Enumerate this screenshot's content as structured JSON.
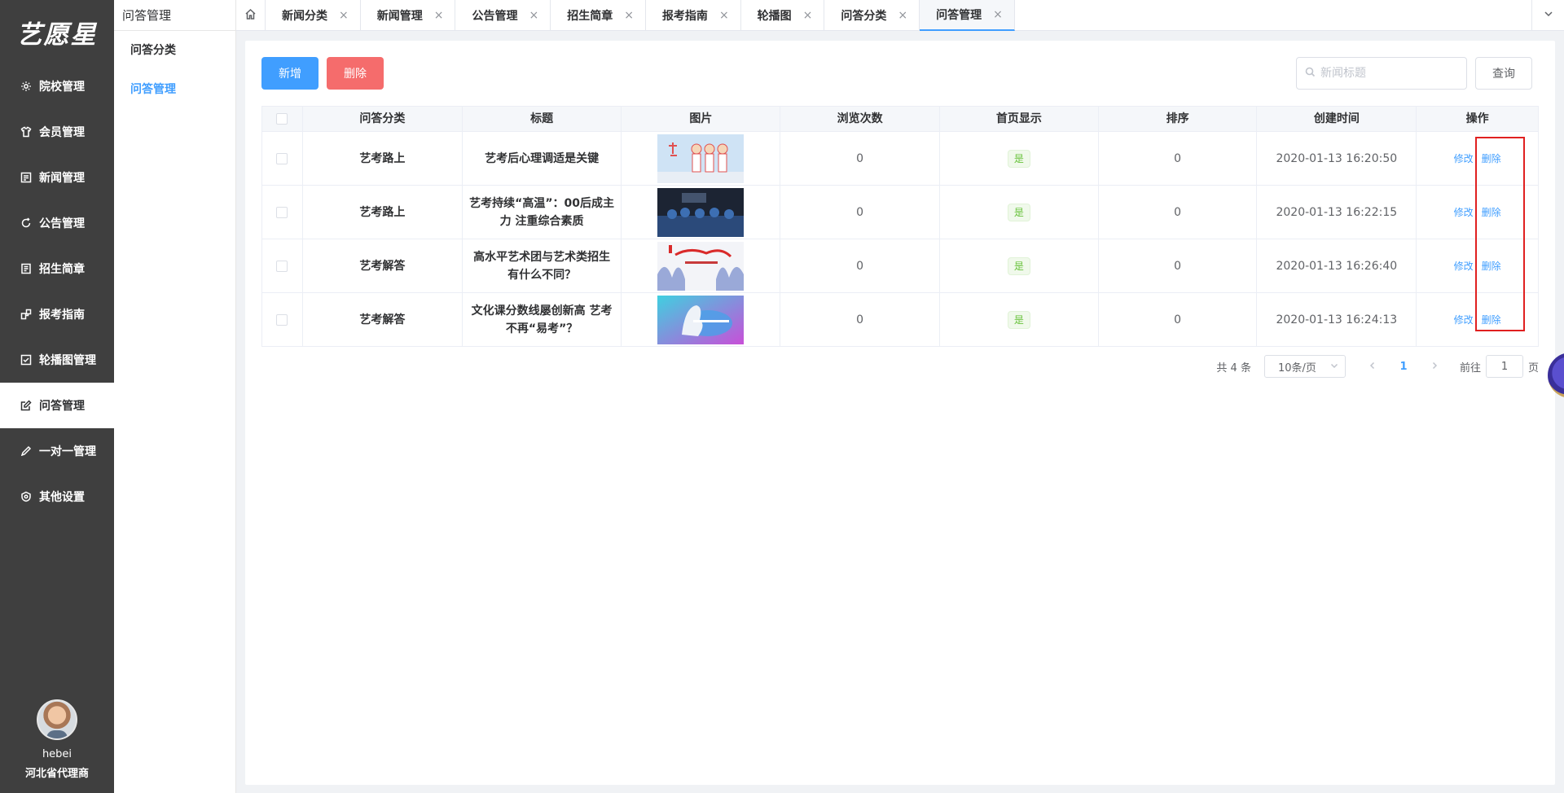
{
  "brand": {
    "logo_text": "艺愿星"
  },
  "sidebar": {
    "items": [
      {
        "label": "院校管理",
        "icon": "gear-icon"
      },
      {
        "label": "会员管理",
        "icon": "shirt-icon"
      },
      {
        "label": "新闻管理",
        "icon": "document-icon"
      },
      {
        "label": "公告管理",
        "icon": "refresh-icon"
      },
      {
        "label": "招生简章",
        "icon": "clipboard-icon"
      },
      {
        "label": "报考指南",
        "icon": "share-icon"
      },
      {
        "label": "轮播图管理",
        "icon": "checkbox-icon"
      },
      {
        "label": "问答管理",
        "icon": "edit-icon",
        "active": true
      },
      {
        "label": "一对一管理",
        "icon": "pencil-icon"
      },
      {
        "label": "其他设置",
        "icon": "badge-icon"
      }
    ],
    "user": {
      "name": "hebei",
      "role": "河北省代理商"
    }
  },
  "submenu": {
    "title": "问答管理",
    "items": [
      {
        "label": "问答分类"
      },
      {
        "label": "问答管理",
        "active": true
      }
    ]
  },
  "tabs": [
    {
      "label": "新闻分类"
    },
    {
      "label": "新闻管理"
    },
    {
      "label": "公告管理"
    },
    {
      "label": "招生简章"
    },
    {
      "label": "报考指南"
    },
    {
      "label": "轮播图"
    },
    {
      "label": "问答分类"
    },
    {
      "label": "问答管理",
      "active": true
    }
  ],
  "tab_close_glyph": "×",
  "toolbar": {
    "add_label": "新增",
    "delete_label": "删除",
    "search_placeholder": "新闻标题",
    "query_label": "查询"
  },
  "table": {
    "headers": [
      "问答分类",
      "标题",
      "图片",
      "浏览次数",
      "首页显示",
      "排序",
      "创建时间",
      "操作"
    ],
    "rows": [
      {
        "category": "艺考路上",
        "title": "艺考后心理调适是关键",
        "views": "0",
        "home": "是",
        "sort": "0",
        "created": "2020-01-13 16:20:50",
        "edit": "修改",
        "delete": "删除"
      },
      {
        "category": "艺考路上",
        "title": "艺考持续“高温”：00后成主力 注重综合素质",
        "views": "0",
        "home": "是",
        "sort": "0",
        "created": "2020-01-13 16:22:15",
        "edit": "修改",
        "delete": "删除"
      },
      {
        "category": "艺考解答",
        "title": "高水平艺术团与艺术类招生有什么不同？",
        "views": "0",
        "home": "是",
        "sort": "0",
        "created": "2020-01-13 16:26:40",
        "edit": "修改",
        "delete": "删除"
      },
      {
        "category": "艺考解答",
        "title": "文化课分数线屡创新高 艺考不再“易考”？",
        "views": "0",
        "home": "是",
        "sort": "0",
        "created": "2020-01-13 16:24:13",
        "edit": "修改",
        "delete": "删除"
      }
    ]
  },
  "pagination": {
    "total": "共 4 条",
    "page_size": "10条/页",
    "current_page": "1",
    "goto_prefix": "前往",
    "goto_value": "1",
    "goto_suffix": "页"
  },
  "colors": {
    "primary": "#409eff",
    "danger": "#f56c6c",
    "success": "#67c23a",
    "sidebar_bg": "#3f3f3f",
    "highlight": "#e02020"
  }
}
